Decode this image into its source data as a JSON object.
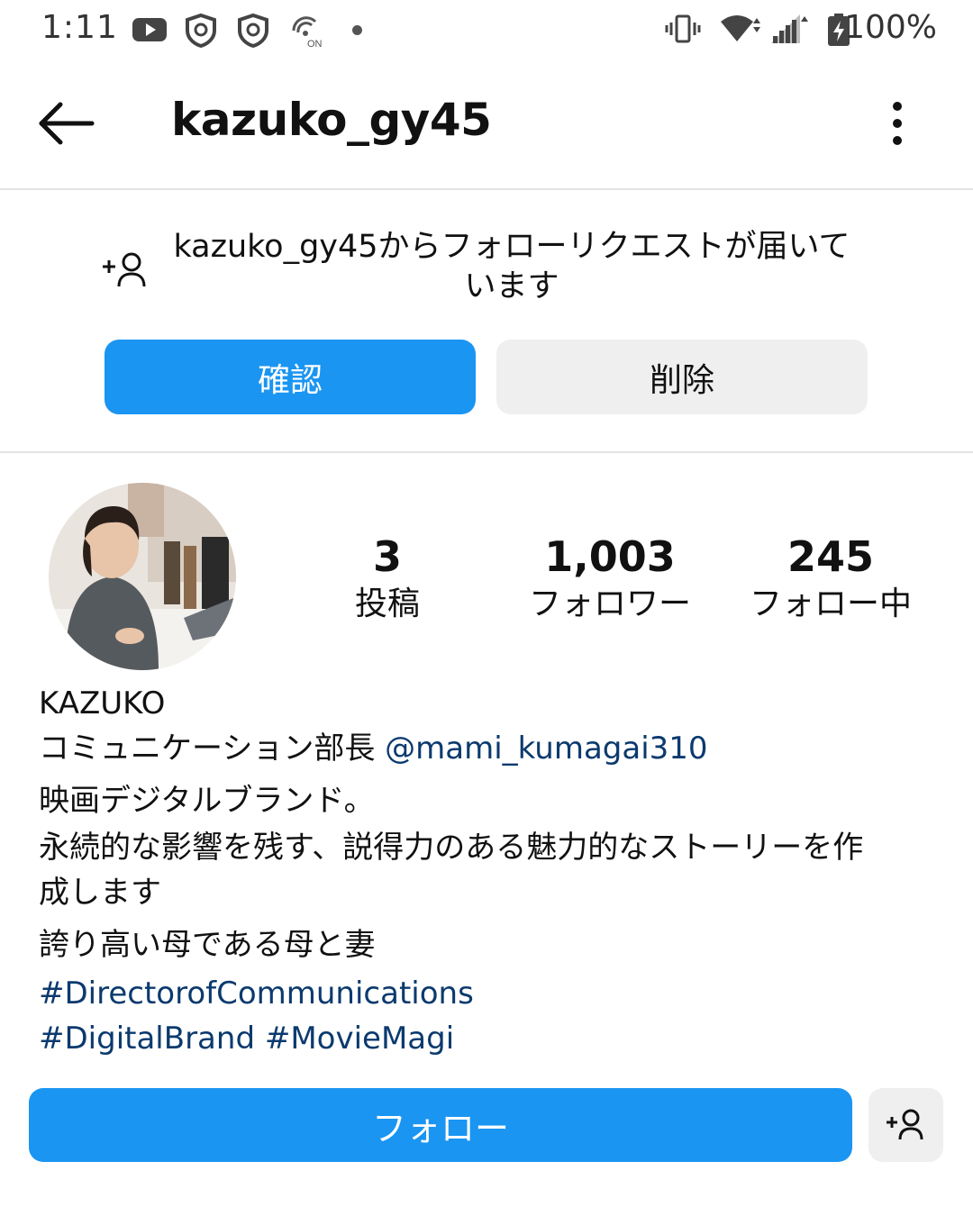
{
  "status_bar": {
    "time": "1:11",
    "battery": "100%",
    "icons": [
      "youtube-icon",
      "shield-icon",
      "shield-icon",
      "hotspot-on-icon",
      "dot-icon",
      "vibrate-icon",
      "wifi-icon",
      "signal-icon",
      "battery-charging-icon"
    ]
  },
  "header": {
    "title": "kazuko_gy45",
    "back_icon": "arrow-left-icon",
    "menu_icon": "more-vertical-icon"
  },
  "follow_request": {
    "icon": "add-user-icon",
    "message_line1": "kazuko_gy45からフォローリクエストが届いて",
    "message_line2": "います",
    "confirm_label": "確認",
    "delete_label": "削除"
  },
  "profile": {
    "stats": [
      {
        "value": "3",
        "label": "投稿"
      },
      {
        "value": "1,003",
        "label": "フォロワー"
      },
      {
        "value": "245",
        "label": "フォロー中"
      }
    ],
    "name": "KAZUKO",
    "bio": {
      "line1_text": "コミュニケーション部長 ",
      "line1_mention": "@mami_kumagai310",
      "line2": "映画デジタルブランド。",
      "line3": "永続的な影響を残す、説得力のある魅力的なストーリーを作",
      "line4": "成します",
      "line5": "誇り高い母である母と妻",
      "hashtag1": "#DirectorofCommunications",
      "hashtag2": "#DigitalBrand",
      "hashtag3": "#MovieMagi"
    },
    "follow_label": "フォロー"
  },
  "colors": {
    "primary": "#1a95f2",
    "secondary_button": "#efefef",
    "link": "#0b3a6e",
    "divider": "#e3e3e3"
  }
}
